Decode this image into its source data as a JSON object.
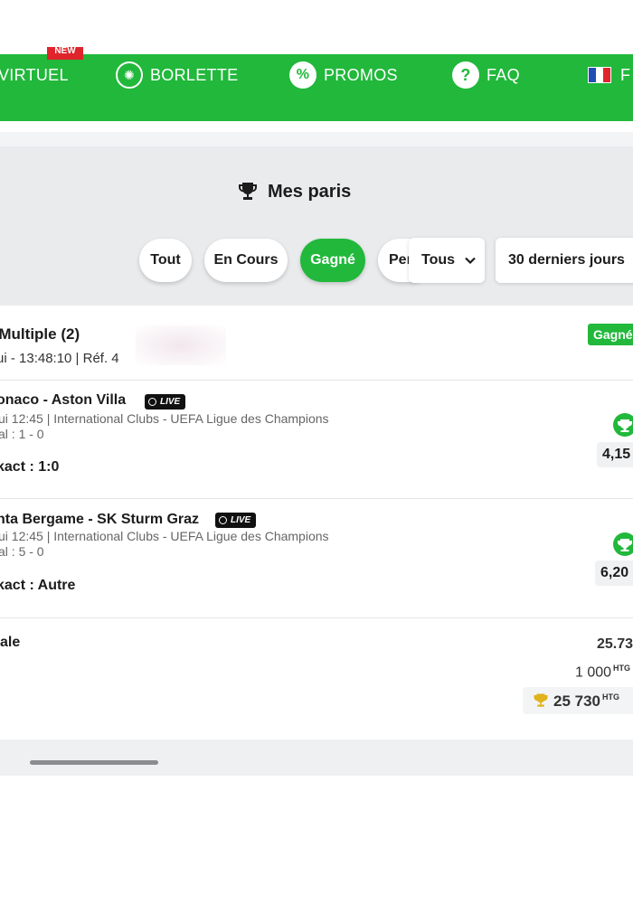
{
  "nav": {
    "items": [
      {
        "label": "VIRTUEL",
        "icon": "virtual-icon"
      },
      {
        "label": "BORLETTE",
        "icon": "lottery-ball-icon"
      },
      {
        "label": "PROMOS",
        "icon": "percent-icon"
      },
      {
        "label": "FAQ",
        "icon": "question-icon"
      },
      {
        "label": "F",
        "icon": "france-flag-icon"
      }
    ],
    "new_badge": "NEW",
    "colors": {
      "brand_green": "#21b83b",
      "badge_red": "#e0242b"
    }
  },
  "page": {
    "title": "Mes paris"
  },
  "filters": {
    "tabs": [
      {
        "label": "Tout",
        "active": false
      },
      {
        "label": "En Cours",
        "active": false
      },
      {
        "label": "Gagné",
        "active": true
      },
      {
        "label": "Per",
        "active": false
      }
    ],
    "type_select": "Tous",
    "period_select": "30 derniers jours"
  },
  "bet": {
    "type": "- Multiple (2)",
    "meta": "ui - 13:48:10 | Réf. 4",
    "status": "Gagné",
    "selections": [
      {
        "match": "onaco - Aston Villa",
        "live_label": "LIVE",
        "info": "ui 12:45 |  International Clubs  -  UEFA Ligue des Champions",
        "final": "al : 1 - 0",
        "market": "kact : 1:0",
        "odds": "4,15"
      },
      {
        "match": "nta Bergame - SK Sturm Graz",
        "live_label": "LIVE",
        "info": "ui 12:45 |  International Clubs  -  UEFA Ligue des Champions",
        "final": "al : 5 - 0",
        "market": "kact : Autre",
        "odds": "6,20"
      }
    ],
    "total_label": "ale",
    "total_odds": "25.73",
    "stake": "1 000",
    "payout": "25 730",
    "currency": "HTG"
  }
}
